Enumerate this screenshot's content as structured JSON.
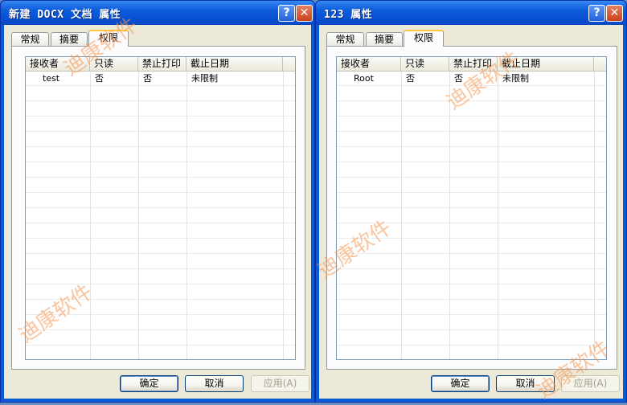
{
  "windows": [
    {
      "title": "新建 DOCX 文档 属性",
      "help_label": "?",
      "close_label": "✕",
      "tabs": [
        "常规",
        "摘要",
        "权限"
      ],
      "active_tab": 2,
      "columns": [
        "接收者",
        "只读",
        "禁止打印",
        "截止日期"
      ],
      "rows": [
        {
          "recipient": "test",
          "readonly": "否",
          "no_print": "否",
          "deadline": "未限制"
        }
      ],
      "buttons": {
        "ok": "确定",
        "cancel": "取消",
        "apply": "应用(A)"
      }
    },
    {
      "title": "123 属性",
      "help_label": "?",
      "close_label": "✕",
      "tabs": [
        "常规",
        "摘要",
        "权限"
      ],
      "active_tab": 2,
      "columns": [
        "接收者",
        "只读",
        "禁止打印",
        "截止日期"
      ],
      "rows": [
        {
          "recipient": "Root",
          "readonly": "否",
          "no_print": "否",
          "deadline": "未限制"
        }
      ],
      "buttons": {
        "ok": "确定",
        "cancel": "取消",
        "apply": "应用(A)"
      }
    }
  ],
  "watermark": "迪康软件",
  "colors": {
    "titlebar": "#0752d5",
    "dialog_bg": "#ece9d8",
    "active_tab_accent": "#ffc83c",
    "watermark": "#f59650"
  }
}
